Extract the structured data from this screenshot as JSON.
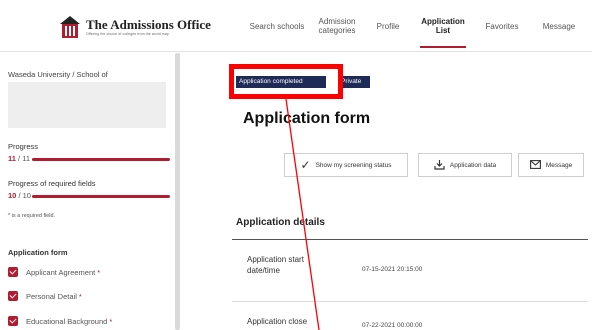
{
  "header": {
    "logo_title": "The Admissions Office",
    "logo_subtitle": "Offering the choice of colleges from the world map",
    "nav": [
      {
        "label": "Search schools"
      },
      {
        "label": "Admission categories"
      },
      {
        "label": "Profile"
      },
      {
        "label": "Application List",
        "active": true
      },
      {
        "label": "Favorites"
      },
      {
        "label": "Message"
      }
    ]
  },
  "sidebar": {
    "university": "Waseda University / School of",
    "progress_label": "Progress",
    "progress_value": "11",
    "progress_total": "/ 11",
    "progress_fraction": 1.0,
    "required_label": "Progress of required fields",
    "required_value": "10",
    "required_total": "/ 10",
    "required_fraction": 1.0,
    "required_note": "is a required field.",
    "required_star": "*",
    "form_heading": "Application form",
    "form_items": [
      {
        "label": "Applicant Agreement",
        "required": "*"
      },
      {
        "label": "Personal Detail",
        "required": "*"
      },
      {
        "label": "Educational Background",
        "required": "*"
      }
    ]
  },
  "main": {
    "status_badge": "Application completed",
    "private_badge": "Private",
    "title": "Application form",
    "buttons": {
      "screening": "Show my screening status",
      "data": "Application data",
      "message": "Message"
    },
    "section_title": "Application details",
    "details": [
      {
        "label": "Application start date/time",
        "value": "07-15-2021 20:15:00"
      },
      {
        "label": "Application close",
        "value": "07-22-2021 00:00:00"
      }
    ]
  },
  "colors": {
    "accent": "#b11c30",
    "badge": "#1e2b57",
    "annotation": "#ff0000"
  }
}
